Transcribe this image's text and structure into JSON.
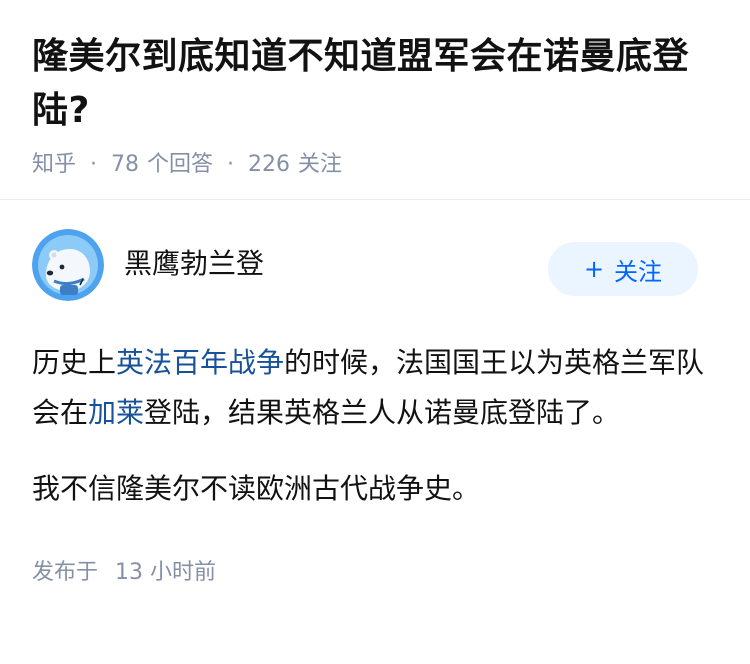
{
  "question": {
    "title": "隆美尔到底知道不知道盟军会在诺曼底登陆?",
    "source": "知乎",
    "answer_count": "78",
    "answer_label": "个回答",
    "follow_count": "226",
    "follow_label": "关注"
  },
  "answer": {
    "author": {
      "name": "黑鹰勃兰登",
      "avatar_icon": "polar-bear-astronaut-avatar"
    },
    "follow_button": {
      "icon": "plus-icon",
      "plus": "+",
      "label": "关注"
    },
    "paragraph1": {
      "part1": "历史上",
      "link1": "英法百年战争",
      "part2": "的时候，法国国王以为英格兰军队会在",
      "link2": "加莱",
      "part3": "登陆，结果英格兰人从诺曼底登陆了。"
    },
    "paragraph2": "我不信隆美尔不读欧洲古代战争史。",
    "publish": {
      "label": "发布于",
      "time": "13 小时前"
    }
  },
  "colors": {
    "link": "#175199",
    "meta": "#8590a6",
    "follow_bg": "#ebf5ff",
    "follow_text": "#0066ff",
    "avatar_bg": "#4da3f0"
  }
}
